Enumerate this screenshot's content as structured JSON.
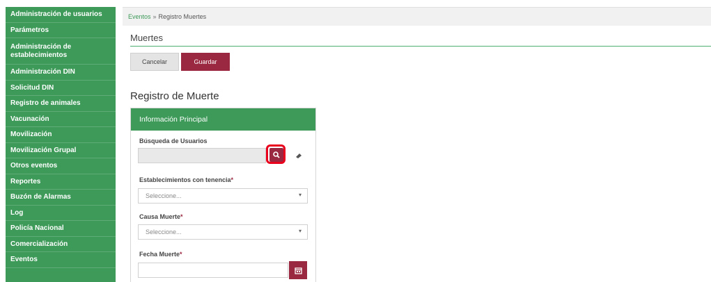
{
  "sidebar": {
    "items": [
      {
        "label": "Administración de usuarios"
      },
      {
        "label": "Parámetros"
      },
      {
        "label": "Administración de establecimientos"
      },
      {
        "label": "Administración DIN"
      },
      {
        "label": "Solicitud DIN"
      },
      {
        "label": "Registro de animales"
      },
      {
        "label": "Vacunación"
      },
      {
        "label": "Movilización"
      },
      {
        "label": "Movilización Grupal"
      },
      {
        "label": "Otros eventos"
      },
      {
        "label": "Reportes"
      },
      {
        "label": "Buzón de Alarmas"
      },
      {
        "label": "Log"
      },
      {
        "label": "Policía Nacional"
      },
      {
        "label": "Comercialización"
      },
      {
        "label": "Eventos"
      }
    ]
  },
  "breadcrumb": {
    "parent": "Eventos",
    "separator": "»",
    "current": "Registro Muertes"
  },
  "page": {
    "title": "Muertes"
  },
  "toolbar": {
    "cancel_label": "Cancelar",
    "save_label": "Guardar"
  },
  "form": {
    "title": "Registro de Muerte",
    "panel_title": "Información Principal",
    "user_search": {
      "label": "Búsqueda de Usuarios",
      "value": ""
    },
    "establishment": {
      "label": "Establecimientos con tenencia",
      "required_mark": "*",
      "placeholder": "Seleccione..."
    },
    "cause": {
      "label": "Causa Muerte",
      "required_mark": "*",
      "placeholder": "Seleccione..."
    },
    "date": {
      "label": "Fecha Muerte",
      "required_mark": "*",
      "value": ""
    }
  },
  "icons": {
    "search": "search-icon",
    "eraser": "eraser-icon",
    "calendar": "calendar-icon",
    "dropdown": "caret-down-icon"
  },
  "colors": {
    "sidebar": "#3d9a59",
    "primary_button": "#9b2841",
    "highlight": "#e8001c"
  }
}
